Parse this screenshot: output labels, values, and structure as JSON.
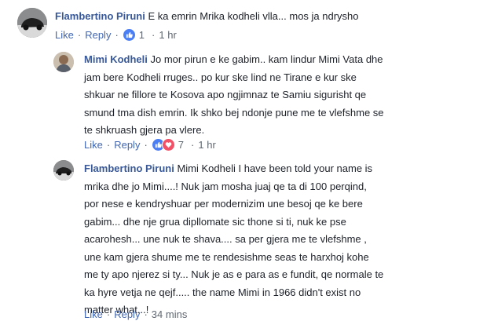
{
  "comments": [
    {
      "author": "Flambertino Piruni",
      "lines": [
        "E ka emrin Mrika kodheli vlla... mos ja ndrysho"
      ],
      "like": "Like",
      "reply": "Reply",
      "reaction_count": "1",
      "time": "1 hr",
      "reactions": [
        "like-icon"
      ]
    },
    {
      "author": "Mimi Kodheli",
      "lines": [
        "Jo mor pirun e ke gabim.. kam lindur Mimi Vata dhe",
        "jam bere Kodheli rruges.. po kur ske lind ne Tirane e kur ske",
        "shkuar ne fillore te Kosova apo ngjimnaz te Samiu sigurisht qe",
        "smund tma dish emrin. Ik shko bej ndonje pune me te vlefshme se",
        "te shkruash gjera pa vlere."
      ],
      "like": "Like",
      "reply": "Reply",
      "reaction_count": "7",
      "time": "1 hr",
      "reactions": [
        "like-icon",
        "love-icon"
      ]
    },
    {
      "author": "Flambertino Piruni",
      "lines": [
        "Mimi Kodheli I have been told your name is",
        "mrika dhe jo Mimi....! Nuk jam mosha juaj qe ta di 100 perqind,",
        "por nese e kendryshuar per modernizim une besoj qe ke bere",
        "gabim... dhe nje grua dipllomate sic thone si ti, nuk ke pse",
        "acarohesh... une nuk te shava.... sa per gjera me te vlefshme ,",
        "une kam gjera shume me te rendesishme seas te harxhoj kohe",
        "me ty apo njerez si ty... Nuk je as e para as e fundit, qe normale te",
        "ka hyre vetja ne qejf..... the name Mimi in 1966 didn't exist no",
        "matter what...!"
      ],
      "like": "Like",
      "reply": "Reply",
      "time": "34 mins"
    }
  ],
  "separator": "·",
  "colors": {
    "name": "#385898",
    "link": "#4267b2",
    "meta": "#606770",
    "like_blue": "#4a7ef5",
    "love_red": "#f25268"
  }
}
